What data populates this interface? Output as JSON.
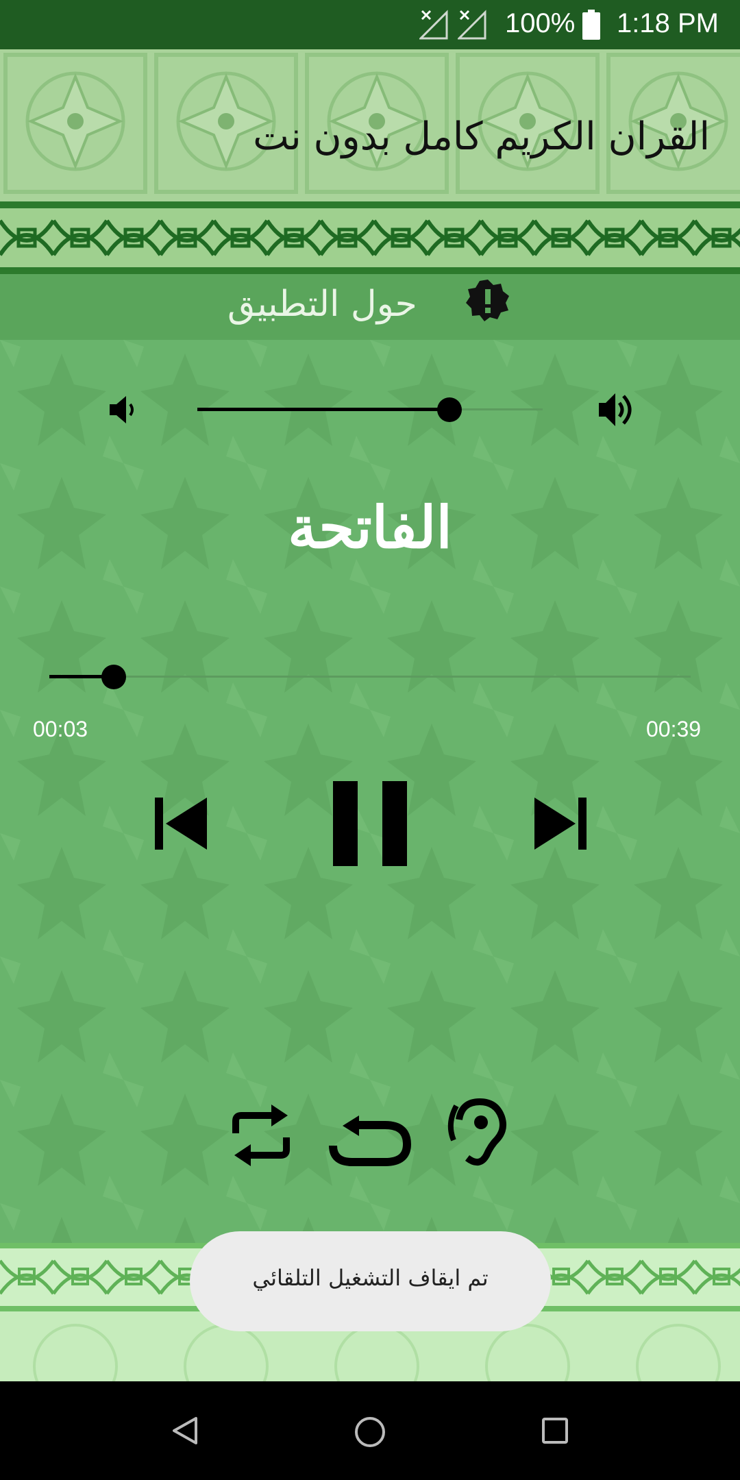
{
  "status_bar": {
    "battery_percent": "100%",
    "time": "1:18 PM"
  },
  "header": {
    "title": "القران الكريم كامل بدون نت"
  },
  "about_bar": {
    "label": "حول التطبيق"
  },
  "player": {
    "volume_level": 0.73,
    "surah_name": "الفاتحة",
    "position_fraction": 0.1,
    "elapsed": "00:03",
    "duration": "00:39"
  },
  "toast": {
    "message": "تم ايقاف التشغيل التلقائي"
  },
  "colors": {
    "status_bar": "#1f5c22",
    "main_bg": "#69b46c",
    "accent": "#000000"
  }
}
